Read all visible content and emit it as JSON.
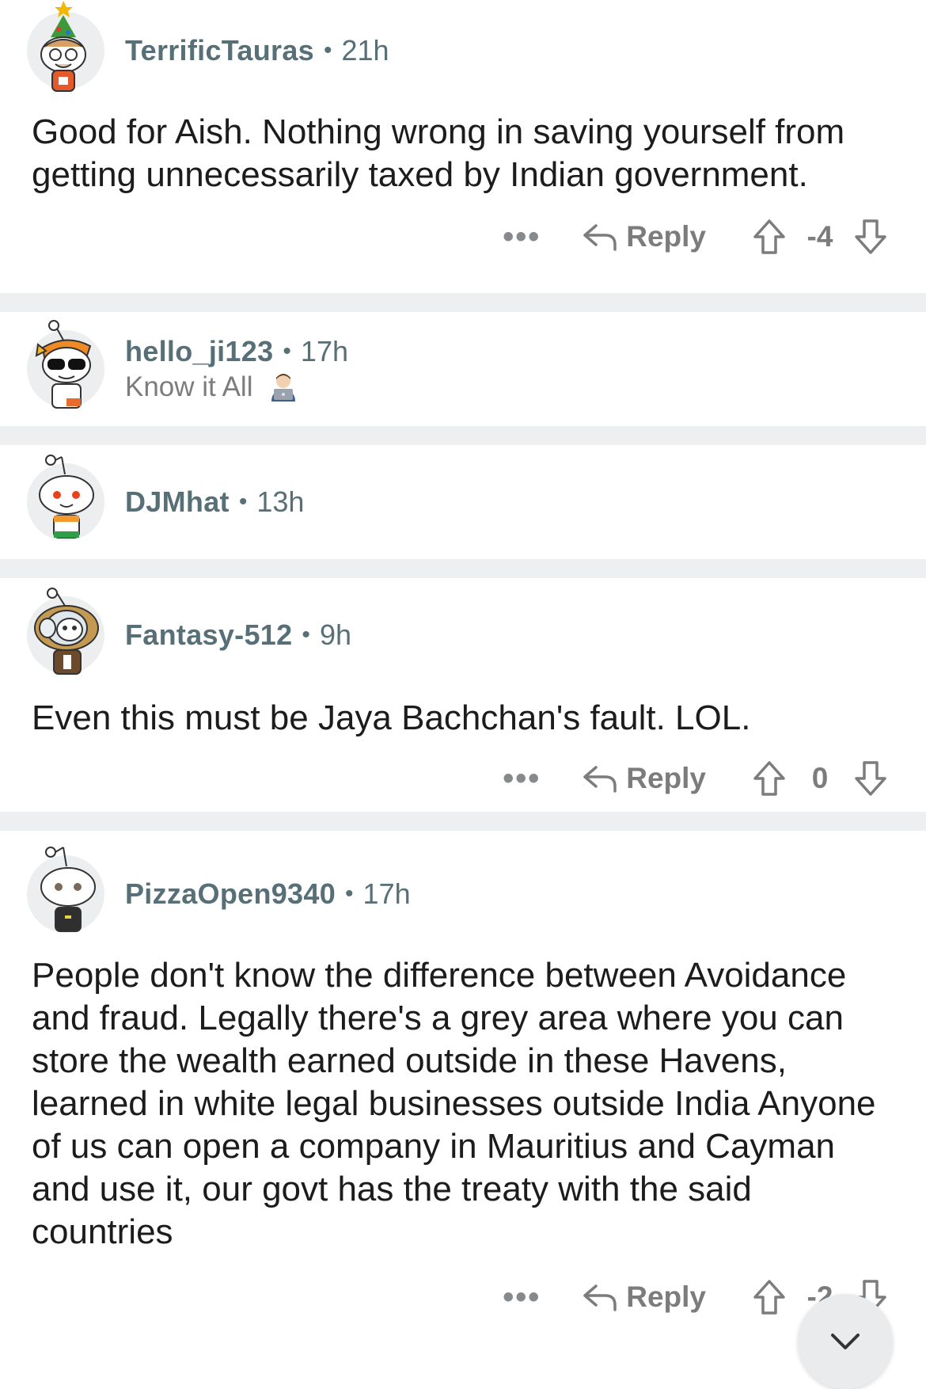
{
  "comments": [
    {
      "username": "TerrificTauras",
      "time": "21h",
      "body": "Good for Aish. Nothing wrong in saving yourself from getting unnecessarily taxed by Indian government.",
      "more": "•••",
      "reply_label": "Reply",
      "score": "-4"
    },
    {
      "username": "hello_ji123",
      "time": "17h",
      "flair": "Know it All"
    },
    {
      "username": "DJMhat",
      "time": "13h"
    },
    {
      "username": "Fantasy-512",
      "time": "9h",
      "body": "Even this must be Jaya Bachchan's fault. LOL.",
      "more": "•••",
      "reply_label": "Reply",
      "score": "0"
    },
    {
      "username": "PizzaOpen9340",
      "time": "17h",
      "body": "People don't know the difference between Avoidance and fraud. Legally there's a grey area where you can store the wealth earned outside in these Havens, learned in white legal businesses outside India Anyone of us can open a company in Mauritius and Cayman and use it, our govt has the treaty with the said countries",
      "more": "•••",
      "reply_label": "Reply",
      "score": "-2"
    }
  ],
  "separator": "•",
  "icons": {
    "reply": "reply-arrow-icon",
    "upvote": "upvote-arrow-icon",
    "downvote": "downvote-arrow-icon",
    "fab": "chevron-down-icon"
  },
  "colors": {
    "meta": "#576f76",
    "action": "#7c7c7c",
    "gap": "#edeff1"
  }
}
